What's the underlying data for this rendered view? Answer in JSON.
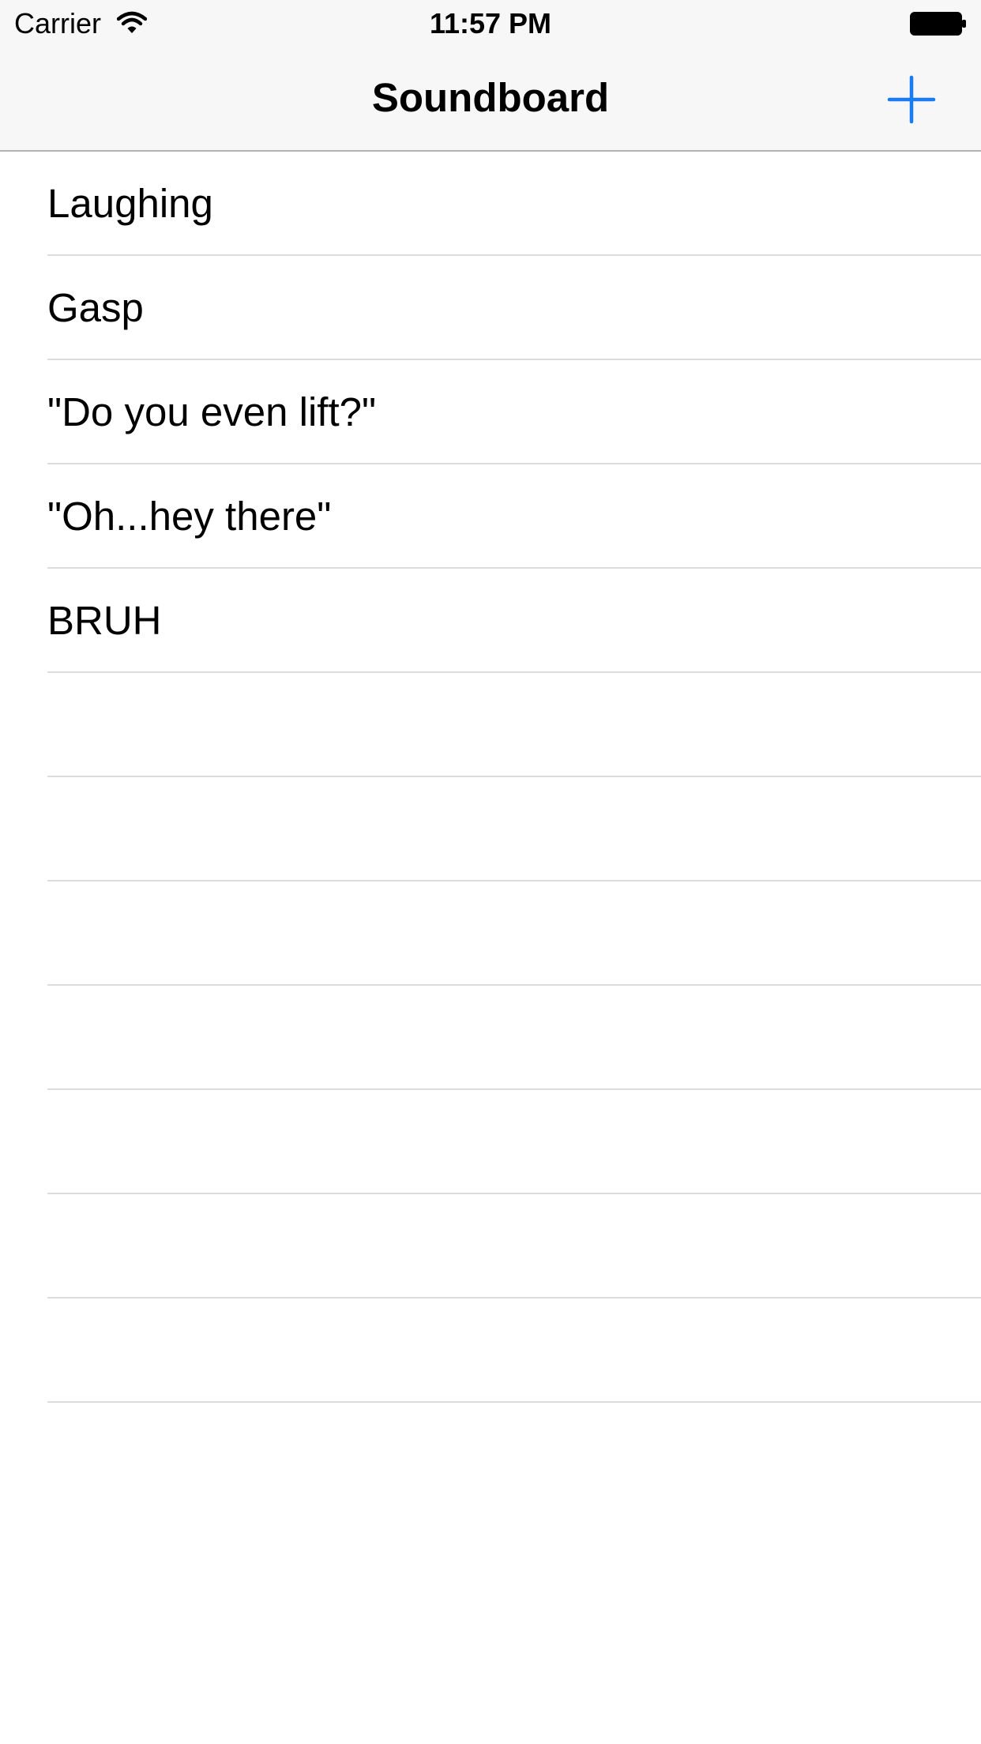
{
  "status_bar": {
    "carrier": "Carrier",
    "time": "11:57 PM",
    "wifi_icon": "wifi-icon",
    "battery_icon": "battery-icon"
  },
  "nav_bar": {
    "title": "Soundboard",
    "add_icon": "plus-icon",
    "accent_color": "#1a7cf0"
  },
  "sounds": [
    {
      "label": "Laughing"
    },
    {
      "label": "Gasp"
    },
    {
      "label": "\"Do you even lift?\""
    },
    {
      "label": "\"Oh...hey there\""
    },
    {
      "label": "BRUH"
    }
  ],
  "empty_rows": 7
}
